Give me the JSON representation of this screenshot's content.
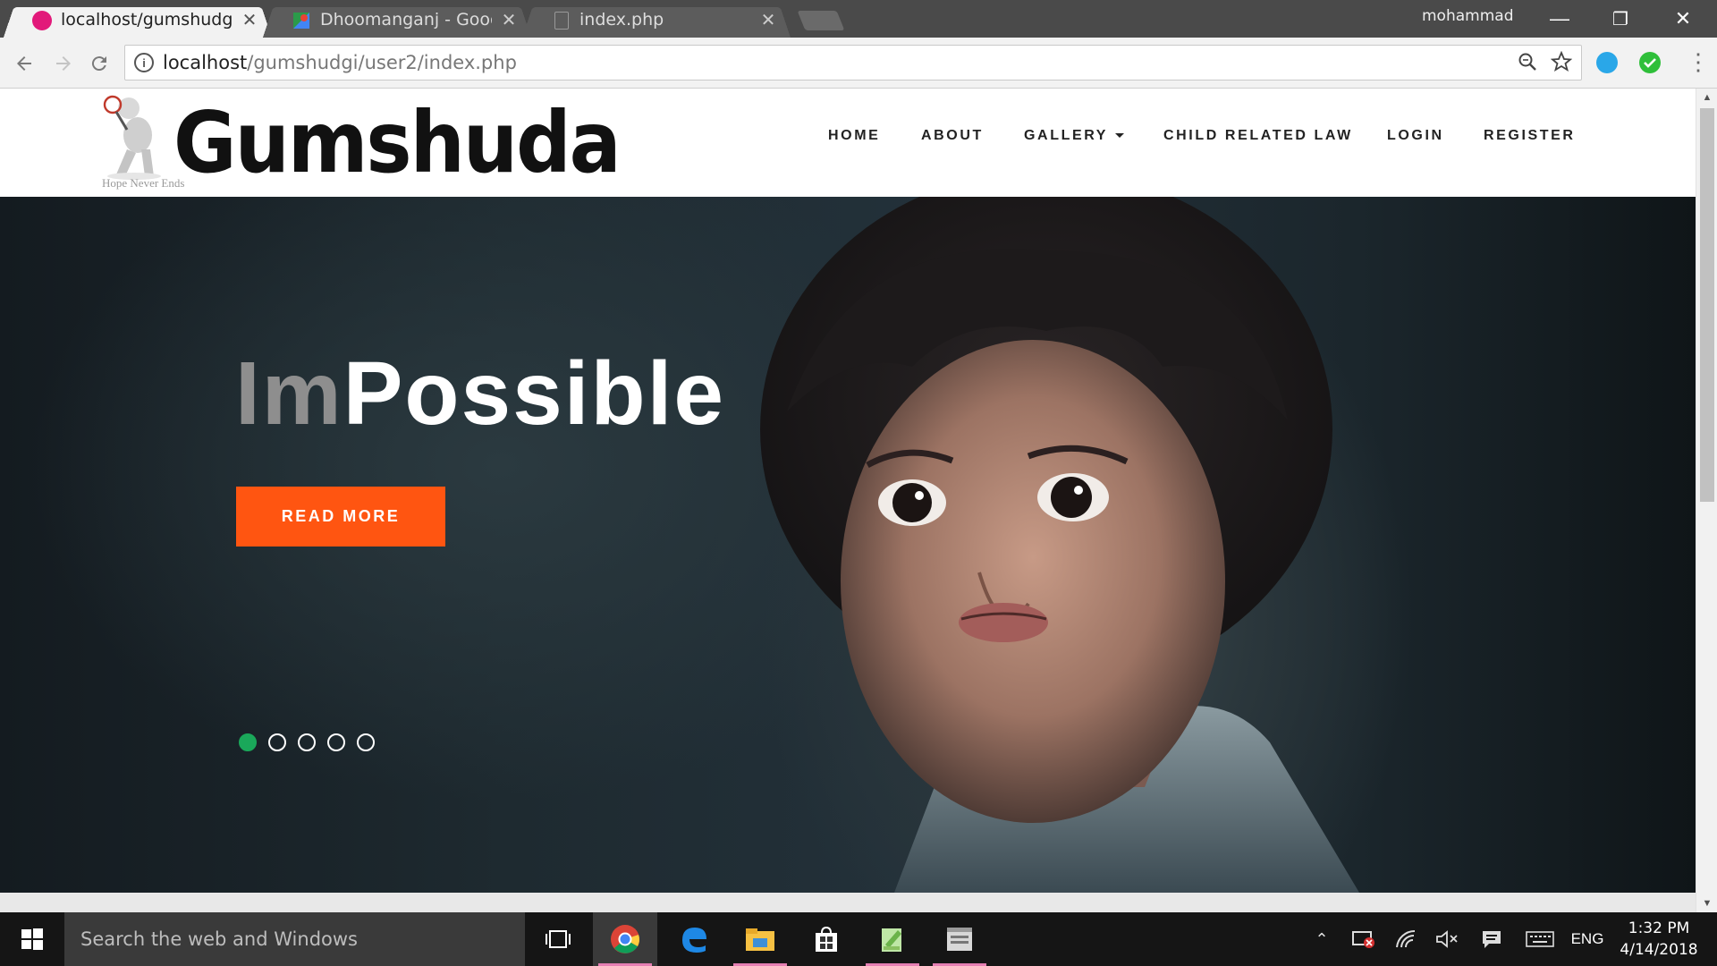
{
  "browser": {
    "profile_name": "mohammad",
    "tabs": [
      {
        "title": "localhost/gumshudgi/use",
        "active": true,
        "favicon": "wamp-icon"
      },
      {
        "title": "Dhoomanganj - Google I",
        "active": false,
        "favicon": "google-maps-icon"
      },
      {
        "title": "index.php",
        "active": false,
        "favicon": "document-icon"
      }
    ],
    "address": {
      "host": "localhost",
      "path": "/gumshudgi/user2/index.php"
    },
    "window_controls": {
      "minimize": "—",
      "restore": "❐",
      "close": "✕"
    },
    "icons": {
      "back": "back-arrow-icon",
      "forward": "forward-arrow-icon",
      "reload": "reload-icon",
      "zoom": "zoom-icon",
      "bookmark": "star-icon",
      "menu": "menu-icon"
    }
  },
  "site": {
    "logo": {
      "wordmark": "Gumshuda",
      "tagline": "Hope Never Ends"
    },
    "nav": {
      "home": "HOME",
      "about": "ABOUT",
      "gallery": "GALLERY",
      "law": "CHILD RELATED LAW",
      "login": "LOGIN",
      "register": "REGISTER"
    },
    "hero": {
      "headline_prefix": "Im",
      "headline_main": "Possible",
      "cta_label": "READ MORE",
      "slides_total": 5,
      "slide_active": 1
    },
    "colors": {
      "cta": "#ff5511",
      "dot_active": "#1aa85a",
      "headline_prefix": "#8e8e8e"
    }
  },
  "taskbar": {
    "search_placeholder": "Search the web and Windows",
    "apps": [
      "task-view-icon",
      "chrome-icon",
      "edge-icon",
      "file-explorer-icon",
      "store-icon",
      "notepad-plus-icon",
      "app-window-icon"
    ],
    "language": "ENG",
    "time": "1:32 PM",
    "date": "4/14/2018"
  }
}
